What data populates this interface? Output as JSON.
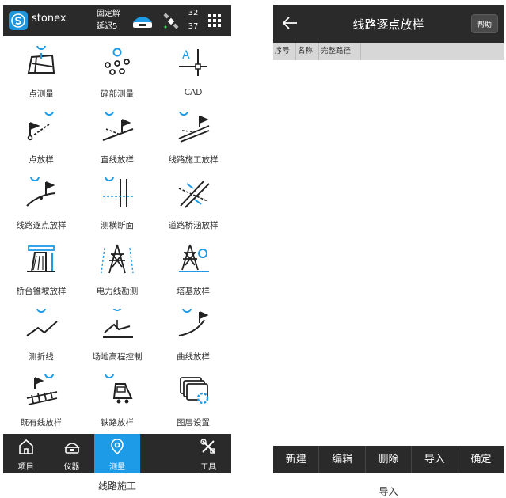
{
  "left_screen": {
    "status": {
      "brand": "stonex",
      "fix_line1": "固定解",
      "fix_line2": "延迟5",
      "sat_top": "32",
      "sat_bottom": "37"
    },
    "menu": [
      {
        "label": "点测量",
        "icon": "point-survey-icon"
      },
      {
        "label": "碎部测量",
        "icon": "detail-survey-icon"
      },
      {
        "label": "CAD",
        "icon": "cad-icon"
      },
      {
        "label": "点放样",
        "icon": "point-stakeout-icon"
      },
      {
        "label": "直线放样",
        "icon": "line-stakeout-icon"
      },
      {
        "label": "线路施工放样",
        "icon": "route-construction-stakeout-icon"
      },
      {
        "label": "线路逐点放样",
        "icon": "route-point-stakeout-icon"
      },
      {
        "label": "测横断面",
        "icon": "cross-section-icon"
      },
      {
        "label": "道路桥涵放样",
        "icon": "road-bridge-stakeout-icon"
      },
      {
        "label": "桥台锥坡放样",
        "icon": "abutment-slope-stakeout-icon"
      },
      {
        "label": "电力线勘测",
        "icon": "power-line-survey-icon"
      },
      {
        "label": "塔基放样",
        "icon": "tower-base-stakeout-icon"
      },
      {
        "label": "测折线",
        "icon": "polyline-survey-icon"
      },
      {
        "label": "场地高程控制",
        "icon": "site-elevation-icon"
      },
      {
        "label": "曲线放样",
        "icon": "curve-stakeout-icon"
      },
      {
        "label": "既有线放样",
        "icon": "existing-rail-stakeout-icon"
      },
      {
        "label": "铁路放样",
        "icon": "railway-stakeout-icon"
      },
      {
        "label": "图层设置",
        "icon": "layer-settings-icon"
      }
    ],
    "tabs": [
      {
        "label": "项目",
        "icon": "home-icon",
        "active": false
      },
      {
        "label": "仪器",
        "icon": "instrument-icon",
        "active": false
      },
      {
        "label": "测量",
        "icon": "location-pin-icon",
        "active": true
      },
      {
        "label": "工具",
        "icon": "tools-icon",
        "active": false
      }
    ],
    "caption": "线路施工"
  },
  "right_screen": {
    "title": "线路逐点放样",
    "help_label": "帮助",
    "columns": [
      "序号",
      "名称",
      "完整路径"
    ],
    "rows": [],
    "footer_buttons": [
      "新建",
      "编辑",
      "删除",
      "导入",
      "确定"
    ],
    "caption": "导入"
  },
  "colors": {
    "bar_bg": "#2a2a2a",
    "accent": "#1e9be6",
    "table_header_bg": "#d7d7d7"
  }
}
